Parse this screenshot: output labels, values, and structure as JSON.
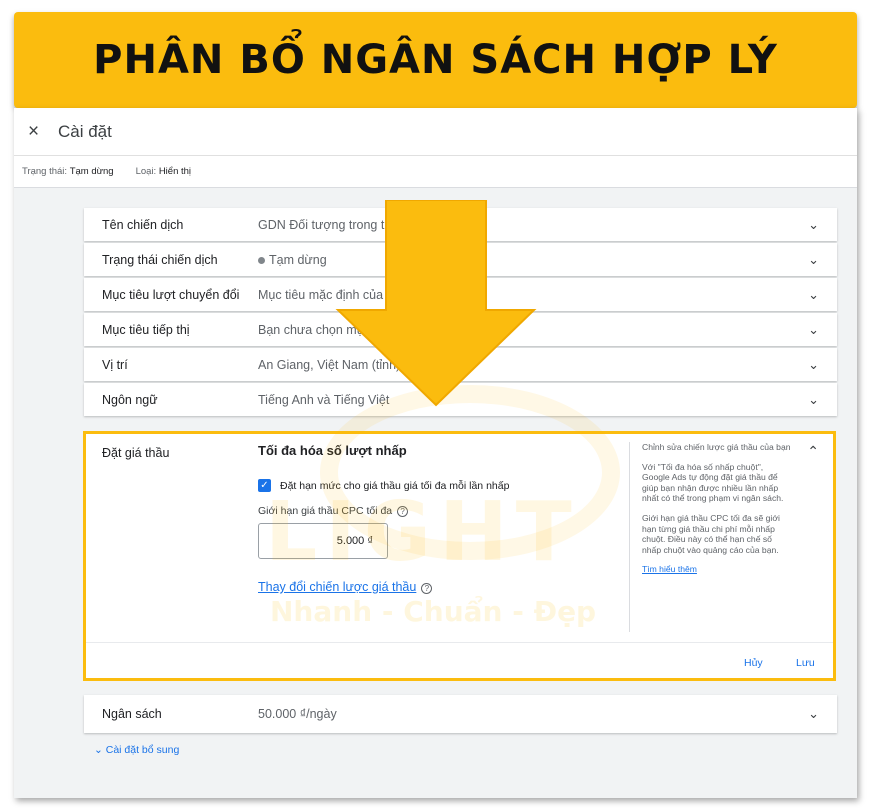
{
  "banner": {
    "title": "PHÂN BỔ NGÂN SÁCH HỢP LÝ"
  },
  "header": {
    "close_icon": "×",
    "title": "Cài đặt"
  },
  "statusbar": {
    "status_label": "Trạng thái:",
    "status_value": "Tạm dừng",
    "type_label": "Loại:",
    "type_value": "Hiển thị"
  },
  "settings": [
    {
      "label": "Tên chiến dịch",
      "value": "GDN Đối tượng trong th"
    },
    {
      "label": "Trạng thái chiến dịch",
      "value": "Tạm dừng"
    },
    {
      "label": "Mục tiêu lượt chuyển đổi",
      "value": "Mục tiêu mặc định của"
    },
    {
      "label": "Mục tiêu tiếp thị",
      "value": "Bạn chưa chọn mụ"
    },
    {
      "label": "Vị trí",
      "value": "An Giang, Việt Nam (tỉnh)"
    },
    {
      "label": "Ngôn ngữ",
      "value": "Tiếng Anh và Tiếng Việt"
    }
  ],
  "bidding": {
    "label": "Đặt giá thầu",
    "strategy": "Tối đa hóa số lượt nhấp",
    "checkbox_label": "Đặt hạn mức cho giá thầu giá tối đa mỗi lần nhấp",
    "checkbox_checked": true,
    "cpc_label": "Giới hạn giá thầu CPC tối đa",
    "cpc_value": "5.000 ₫",
    "change_link": "Thay đổi chiến lược giá thầu",
    "help_title": "Chỉnh sửa chiến lược giá thầu của bạn",
    "help_p1": "Với \"Tối đa hóa số nhấp chuột\", Google Ads tự động đặt giá thầu để giúp bạn nhận được nhiều lần nhấp nhất có thể trong phạm vi ngân sách.",
    "help_p2": "Giới hạn giá thầu CPC tối đa sẽ giới hạn từng giá thầu chi phí mỗi nhấp chuột. Điều này có thể hạn chế số nhấp chuột vào quảng cáo của bạn.",
    "learn_more": "Tìm hiểu thêm",
    "cancel": "Hủy",
    "save": "Lưu"
  },
  "budget": {
    "label": "Ngân sách",
    "value": "50.000 ₫/ngày"
  },
  "more_settings": "Cài đặt bổ sung",
  "watermark": {
    "logo": "LIGHT",
    "tagline": "Nhanh - Chuẩn - Đẹp"
  },
  "colors": {
    "accent": "#fbbc0e",
    "link": "#1a73e8"
  },
  "icons": {
    "row_expand": "chevron-down-icon",
    "collapse": "chevron-up-icon",
    "close": "close-icon",
    "arrow": "down-arrow-icon"
  }
}
